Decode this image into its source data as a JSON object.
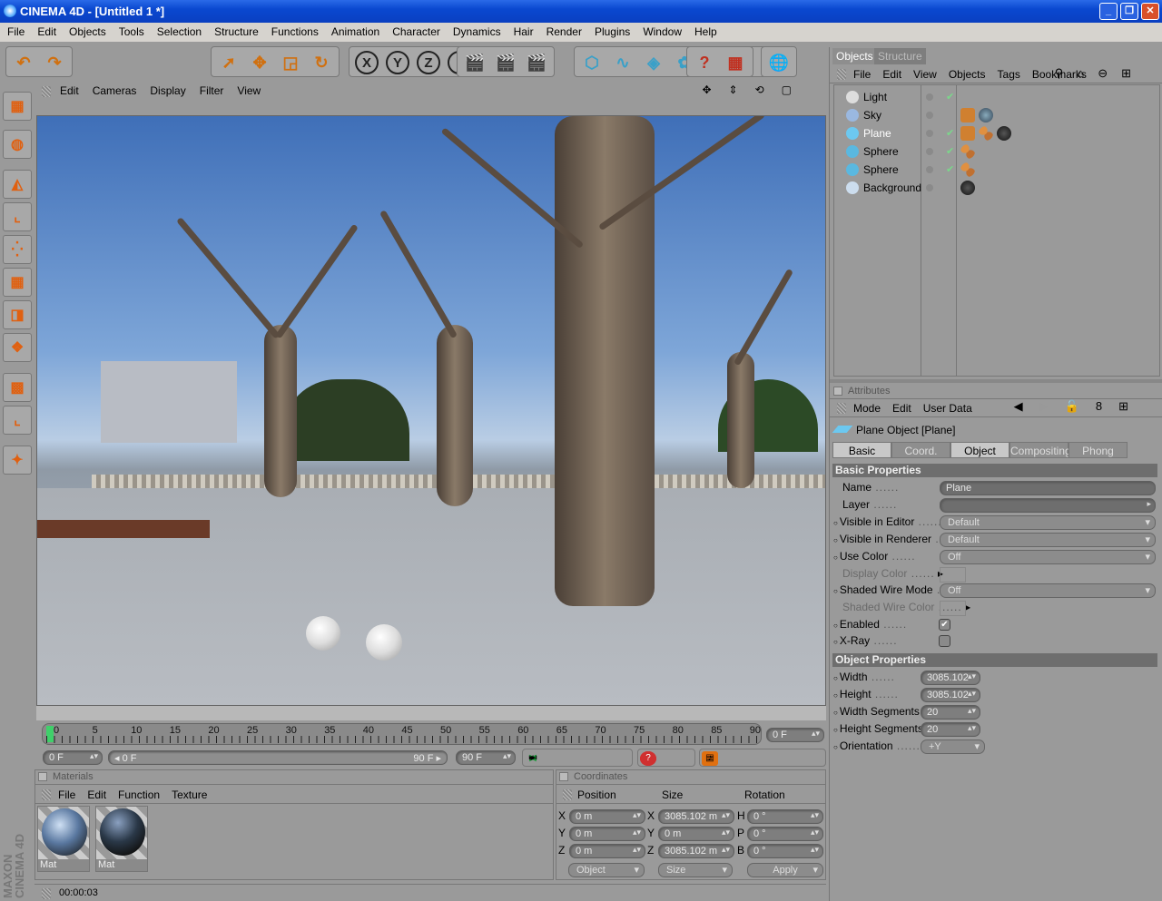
{
  "window": {
    "title": "CINEMA 4D - [Untitled 1 *]",
    "controls": [
      "_",
      "❐",
      "✕"
    ]
  },
  "menubar": [
    "File",
    "Edit",
    "Objects",
    "Tools",
    "Selection",
    "Structure",
    "Functions",
    "Animation",
    "Character",
    "Dynamics",
    "Hair",
    "Render",
    "Plugins",
    "Window",
    "Help"
  ],
  "toolbar": {
    "groups": [
      {
        "icons": [
          {
            "name": "undo-icon",
            "glyph": "↶"
          },
          {
            "name": "redo-icon",
            "glyph": "↷"
          }
        ]
      },
      {
        "icons": [
          {
            "name": "select-pointer-icon",
            "glyph": "➚"
          },
          {
            "name": "move-icon",
            "glyph": "✥"
          },
          {
            "name": "scale-icon",
            "glyph": "◲"
          },
          {
            "name": "rotate-icon",
            "glyph": "↻"
          }
        ]
      },
      {
        "icons": [
          {
            "name": "x-axis-icon",
            "glyph": "X"
          },
          {
            "name": "y-axis-icon",
            "glyph": "Y"
          },
          {
            "name": "z-axis-icon",
            "glyph": "Z"
          },
          {
            "name": "coordinate-system-icon",
            "glyph": "⌞"
          }
        ]
      },
      {
        "icons": [
          {
            "name": "render-view-icon",
            "glyph": "🎬"
          },
          {
            "name": "render-region-icon",
            "glyph": "🎬"
          },
          {
            "name": "render-picture-viewer-icon",
            "glyph": "🎬"
          }
        ]
      },
      {
        "icons": [
          {
            "name": "cube-primitive-icon",
            "glyph": "⬡"
          },
          {
            "name": "spline-icon",
            "glyph": "∿"
          },
          {
            "name": "nurbs-icon",
            "glyph": "◈"
          },
          {
            "name": "array-icon",
            "glyph": "✿"
          },
          {
            "name": "deformer-icon",
            "glyph": "✣"
          },
          {
            "name": "scene-object-icon",
            "glyph": "◐"
          },
          {
            "name": "particle-icon",
            "glyph": "⁘"
          }
        ]
      },
      {
        "icons": [
          {
            "name": "help-pointer-icon",
            "glyph": "?"
          },
          {
            "name": "tagged-help-icon",
            "glyph": "▦"
          }
        ]
      },
      {
        "icons": [
          {
            "name": "web-icon",
            "glyph": "🌐"
          }
        ]
      }
    ]
  },
  "viewport": {
    "menu": [
      "Edit",
      "Cameras",
      "Display",
      "Filter",
      "View"
    ],
    "nav_icons": [
      "✥",
      "⇕",
      "⟲",
      "▢"
    ]
  },
  "timeline": {
    "ticks": [
      "0",
      "5",
      "10",
      "15",
      "20",
      "25",
      "30",
      "35",
      "40",
      "45",
      "50",
      "55",
      "60",
      "65",
      "70",
      "75",
      "80",
      "85",
      "90"
    ],
    "current_frame": "0 F",
    "start": "0 F",
    "range_start": "◂ 0 F",
    "range_end": "90 F ▸",
    "end": "90 F",
    "current_position": 0
  },
  "materials": {
    "title": "Materials",
    "menu": [
      "File",
      "Edit",
      "Function",
      "Texture"
    ],
    "items": [
      {
        "label": "Mat"
      },
      {
        "label": "Mat"
      }
    ]
  },
  "coordinates": {
    "title": "Coordinates",
    "headers": [
      "Position",
      "Size",
      "Rotation"
    ],
    "rows": [
      {
        "pl": "X",
        "pv": "0 m",
        "sl": "X",
        "sv": "3085.102 m",
        "rl": "H",
        "rv": "0 °"
      },
      {
        "pl": "Y",
        "pv": "0 m",
        "sl": "Y",
        "sv": "0 m",
        "rl": "P",
        "rv": "0 °"
      },
      {
        "pl": "Z",
        "pv": "0 m",
        "sl": "Z",
        "sv": "3085.102 m",
        "rl": "B",
        "rv": "0 °"
      }
    ],
    "mode": "Object",
    "size_mode": "Size",
    "apply": "Apply"
  },
  "status": {
    "time": "00:00:03"
  },
  "brand": "MAXON CINEMA 4D",
  "objects": {
    "tabs": [
      "Objects",
      "Structure"
    ],
    "menu": [
      "File",
      "Edit",
      "View",
      "Objects",
      "Tags",
      "Bookmarks"
    ],
    "items": [
      {
        "name": "Light",
        "color": "#ddd"
      },
      {
        "name": "Sky",
        "color": "#9ab8e0"
      },
      {
        "name": "Plane",
        "color": "#6cc8f0",
        "selected": true
      },
      {
        "name": "Sphere",
        "color": "#5ab8e0"
      },
      {
        "name": "Sphere",
        "color": "#5ab8e0"
      },
      {
        "name": "Background",
        "color": "#cde"
      }
    ]
  },
  "attributes": {
    "title": "Attributes",
    "menu": [
      "Mode",
      "Edit",
      "User Data"
    ],
    "object_title": "Plane Object [Plane]",
    "tabs": [
      "Basic",
      "Coord.",
      "Object",
      "Compositing",
      "Phong"
    ],
    "basic_header": "Basic Properties",
    "name_label": "Name",
    "name_value": "Plane",
    "layer_label": "Layer",
    "visible_editor_label": "Visible in Editor",
    "visible_editor": "Default",
    "visible_renderer_label": "Visible in Renderer",
    "visible_renderer": "Default",
    "use_color_label": "Use Color",
    "use_color": "Off",
    "display_color_label": "Display Color",
    "shaded_wire_mode_label": "Shaded Wire Mode",
    "shaded_wire_mode": "Off",
    "shaded_wire_color_label": "Shaded Wire Color",
    "enabled_label": "Enabled",
    "enabled": true,
    "xray_label": "X-Ray",
    "xray": false,
    "object_header": "Object Properties",
    "width_label": "Width",
    "width": "3085.102",
    "height_label": "Height",
    "height": "3085.102",
    "width_segments_label": "Width Segments",
    "width_segments": "20",
    "height_segments_label": "Height Segments",
    "height_segments": "20",
    "orientation_label": "Orientation",
    "orientation": "+Y"
  }
}
